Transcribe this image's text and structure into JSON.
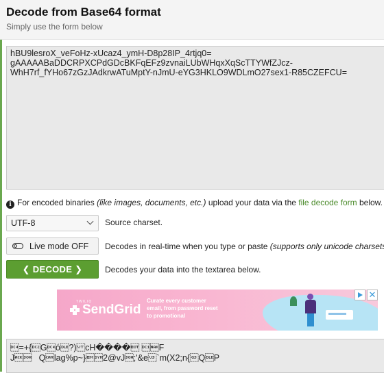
{
  "header": {
    "title": "Decode from Base64 format",
    "subtitle": "Simply use the form below"
  },
  "input": {
    "text": "hBU9lesroX_veFoHz-xUcaz4_ymH-D8p28IP_4rtjq0=\ngAAAAABaDDCRPXCPdGDcBKFqEFz9zvnaiLUbWHqxXqScTTYWfZJcz-\nWhH7rf_fYHo67zGzJAdkrwATuMptY-nJmU-eYG3HKLO9WDLmO27sex1-R85CZEFCU="
  },
  "info": {
    "prefix": "For encoded binaries ",
    "italic": "(like images, documents, etc.)",
    "middle": " upload your data via the ",
    "link": "file decode form",
    "suffix": " below."
  },
  "charset": {
    "selected": "UTF-8",
    "label": "Source charset."
  },
  "live_mode": {
    "label": "Live mode OFF",
    "desc": "Decodes in real-time when you type or paste ",
    "desc_italic": "(supports only unicode charsets"
  },
  "decode": {
    "label": "DECODE",
    "desc": "Decodes your data into the textarea below."
  },
  "ad": {
    "twilio": "TWILIO",
    "brand": "SendGrid",
    "copy": "Curate every customer email, from password reset to promotional"
  },
  "output": {
    "text": "\u0014=+{\u0012G\u0014ó\u0010?)\u000bcH����\u0004 \u0011\u0015F\nJ\u0006\u0001   Q\u0018lag%p~}\u0019\u00162@vJ\u0001;'&e\u001f`m(X2;n{\u001dQ\u0010P"
  },
  "icons": {
    "info": "info-icon",
    "toggle": "toggle-off-icon",
    "select": "chevron-down-icon",
    "decode_left": "chevron-left-icon",
    "decode_right": "chevron-right-icon"
  },
  "colors": {
    "accent_green": "#5c9e31",
    "link_green": "#4a8a2a"
  }
}
